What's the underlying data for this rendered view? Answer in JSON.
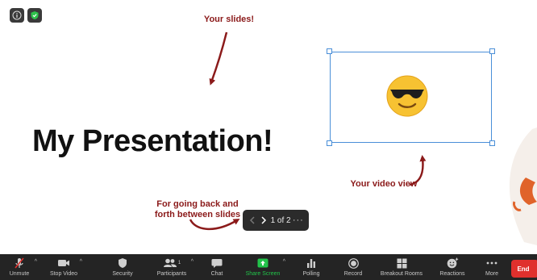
{
  "slide": {
    "title": "My Presentation!",
    "annotations": {
      "slides": "Your slides!",
      "video": "Your video view",
      "nav_line1": "For going back and",
      "nav_line2": "forth between slides"
    }
  },
  "slide_nav": {
    "page": "1 of 2",
    "more": "···",
    "prev_icon": "chevron-left-icon",
    "next_icon": "chevron-right-icon"
  },
  "status_icons": [
    "info-icon",
    "shield-check-icon"
  ],
  "toolbar": {
    "unmute": "Unmute",
    "stop_video": "Stop Video",
    "security": "Security",
    "participants": "Participants",
    "participants_count": "1",
    "chat": "Chat",
    "share_screen": "Share Screen",
    "polling": "Polling",
    "record": "Record",
    "breakout_rooms": "Breakout Rooms",
    "reactions": "Reactions",
    "more": "More",
    "end": "End"
  },
  "colors": {
    "annotation": "#8b1a1a",
    "video_frame": "#4a8fd8",
    "toolbar_bg": "#242424",
    "share_green": "#22c34a",
    "end_red": "#e0302d"
  }
}
